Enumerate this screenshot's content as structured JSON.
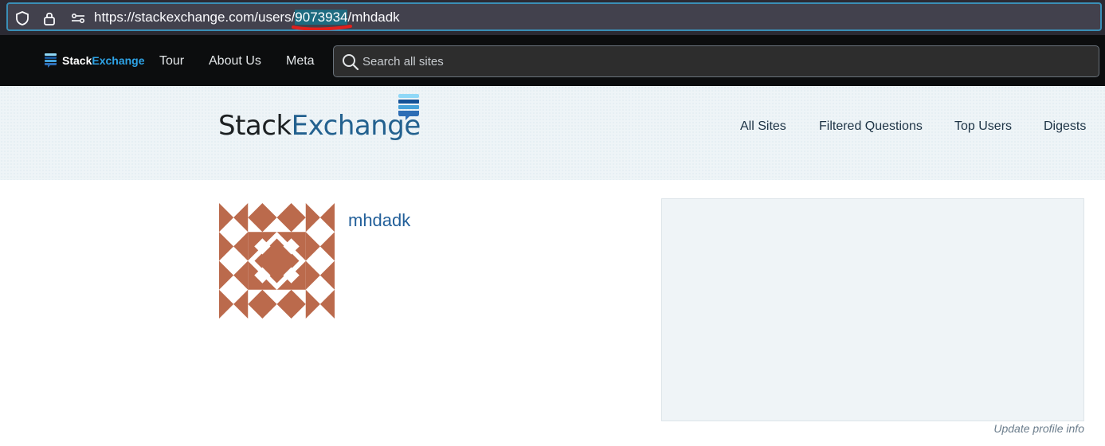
{
  "browser": {
    "url_prefix": "https://stackexchange.com/users/",
    "url_highlight": "9073934",
    "url_suffix": "/mhdadk"
  },
  "topnav": {
    "logo_word1": "Stack",
    "logo_word2": "Exchange",
    "links": [
      "Tour",
      "About Us",
      "Meta"
    ],
    "search_placeholder": "Search all sites"
  },
  "site_header": {
    "logo_word1": "Stack",
    "logo_word2": "Exchange",
    "links": [
      "All Sites",
      "Filtered Questions",
      "Top Users",
      "Digests"
    ]
  },
  "profile": {
    "username": "mhdadk",
    "update_link": "Update profile info"
  },
  "colors": {
    "avatar": "#bb6a4c",
    "accent_blue": "#23609a",
    "url_annotation": "#e0201c"
  }
}
